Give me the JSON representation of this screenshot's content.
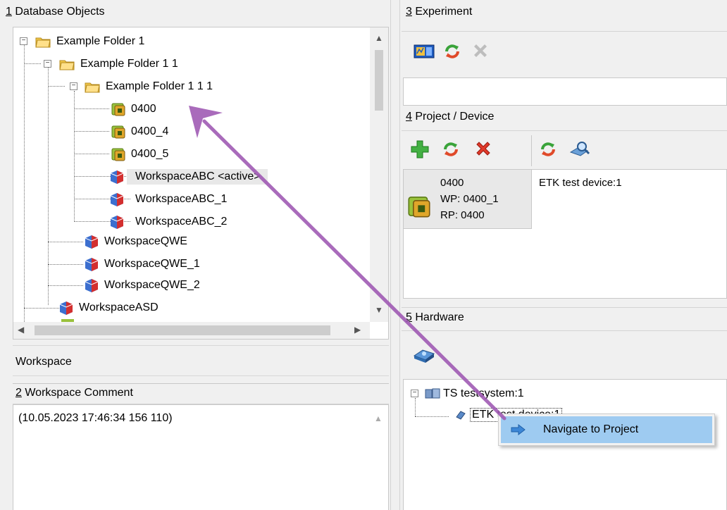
{
  "db_objects": {
    "header_num": "1",
    "header_label": "Database Objects",
    "tree": [
      {
        "label": "Example Folder 1",
        "icon": "folder-icon"
      },
      {
        "label": "Example Folder 1 1",
        "icon": "folder-icon"
      },
      {
        "label": "Example Folder 1 1 1",
        "icon": "folder-icon"
      },
      {
        "label": "0400",
        "icon": "project-icon"
      },
      {
        "label": "0400_4",
        "icon": "project-icon"
      },
      {
        "label": "0400_5",
        "icon": "project-icon"
      },
      {
        "label": "WorkspaceABC <active>",
        "icon": "workspace-icon"
      },
      {
        "label": "WorkspaceABC_1",
        "icon": "workspace-icon"
      },
      {
        "label": "WorkspaceABC_2",
        "icon": "workspace-icon"
      },
      {
        "label": "WorkspaceQWE",
        "icon": "workspace-icon"
      },
      {
        "label": "WorkspaceQWE_1",
        "icon": "workspace-icon"
      },
      {
        "label": "WorkspaceQWE_2",
        "icon": "workspace-icon"
      },
      {
        "label": "WorkspaceASD",
        "icon": "workspace-icon"
      }
    ]
  },
  "workspace_label": "Workspace",
  "workspace_comment": {
    "header_num": "2",
    "header_label": "Workspace Comment",
    "text": "(10.05.2023 17:46:34 156 110)"
  },
  "experiment": {
    "header_num": "3",
    "header_label": "Experiment"
  },
  "project_device": {
    "header_num": "4",
    "header_label": "Project / Device",
    "project_name": "0400",
    "wp": "WP: 0400_1",
    "rp": "RP: 0400",
    "device": "ETK test device:1"
  },
  "hardware": {
    "header_num": "5",
    "header_label": "Hardware",
    "system": "TS testsystem:1",
    "device": "ETK test device:1"
  },
  "context_menu": {
    "item": "Navigate to Project"
  },
  "colors": {
    "selection": "#cce4f7",
    "menu_bg": "#f2f2f2",
    "menu_hover": "#9ecbf1",
    "annotation_arrow": "#a05bb4"
  }
}
